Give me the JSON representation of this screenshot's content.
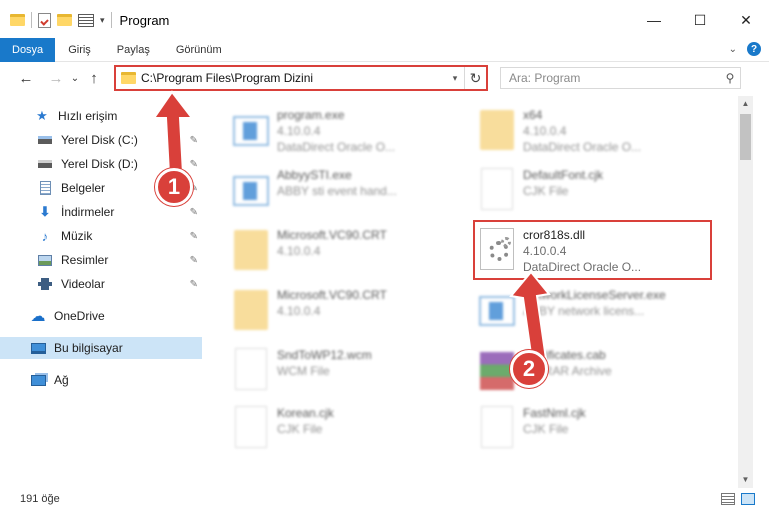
{
  "window": {
    "title": "Program",
    "controls": {
      "minimize": "—",
      "maximize": "☐",
      "close": "✕"
    }
  },
  "ribbon": {
    "tabs": [
      "Dosya",
      "Giriş",
      "Paylaş",
      "Görünüm"
    ],
    "active_tab": "Dosya",
    "help": "?"
  },
  "nav": {
    "back": "←",
    "forward": "→",
    "recent": "⌄",
    "up": "↑",
    "address": "C:\\Program Files\\Program Dizini",
    "search_placeholder": "Ara: Program"
  },
  "sidebar": {
    "items": [
      {
        "label": "Hızlı erişim",
        "icon": "star-icon",
        "pinned": false
      },
      {
        "label": "Yerel Disk (C:)",
        "icon": "drive-icon",
        "pinned": true
      },
      {
        "label": "Yerel Disk (D:)",
        "icon": "drive-icon",
        "pinned": true
      },
      {
        "label": "Belgeler",
        "icon": "documents-icon",
        "pinned": true
      },
      {
        "label": "İndirmeler",
        "icon": "download-icon",
        "pinned": true
      },
      {
        "label": "Müzik",
        "icon": "music-icon",
        "pinned": true
      },
      {
        "label": "Resimler",
        "icon": "pictures-icon",
        "pinned": true
      },
      {
        "label": "Videolar",
        "icon": "videos-icon",
        "pinned": true
      },
      {
        "label": "OneDrive",
        "icon": "cloud-icon",
        "pinned": false
      },
      {
        "label": "Bu bilgisayar",
        "icon": "computer-icon",
        "pinned": false,
        "selected": true
      },
      {
        "label": "Ağ",
        "icon": "network-icon",
        "pinned": false
      }
    ]
  },
  "files": [
    {
      "name": "program.exe",
      "line2": "4.10.0.4",
      "line3": "DataDirect Oracle O...",
      "type": "exe",
      "blurred": true
    },
    {
      "name": "x64",
      "line2": "4.10.0.4",
      "line3": "DataDirect Oracle O...",
      "type": "folder",
      "blurred": true
    },
    {
      "name": "AbbyySTI.exe",
      "line2": "ABBY sti event hand...",
      "line3": "",
      "type": "exe",
      "blurred": true
    },
    {
      "name": "DefaultFont.cjk",
      "line2": "CJK File",
      "line3": "",
      "type": "doc",
      "blurred": true
    },
    {
      "name": "Microsoft.VC90.CRT",
      "line2": "4.10.0.4",
      "line3": "",
      "type": "folder",
      "blurred": true
    },
    {
      "name": "cror818s.dll",
      "line2": "4.10.0.4",
      "line3": "DataDirect Oracle O...",
      "type": "dll",
      "blurred": false
    },
    {
      "name": "Microsoft.VC90.CRT",
      "line2": "4.10.0.4",
      "line3": "",
      "type": "folder",
      "blurred": true
    },
    {
      "name": "NetworkLicenseServer.exe",
      "line2": "ABBY network licens...",
      "line3": "",
      "type": "exe",
      "blurred": true
    },
    {
      "name": "SndToWP12.wcm",
      "line2": "WCM File",
      "line3": "",
      "type": "doc",
      "blurred": true
    },
    {
      "name": "Certificates.cab",
      "line2": "WinRAR Archive",
      "line3": "",
      "type": "rar",
      "blurred": true
    },
    {
      "name": "Korean.cjk",
      "line2": "CJK File",
      "line3": "",
      "type": "doc",
      "blurred": true
    },
    {
      "name": "FastNml.cjk",
      "line2": "CJK File",
      "line3": "",
      "type": "doc",
      "blurred": true
    }
  ],
  "callouts": [
    "1",
    "2"
  ],
  "status": {
    "count": "191 öğe"
  },
  "colors": {
    "accent": "#1979ca",
    "highlight": "#d9403a",
    "selected_bg": "#cce4f7"
  }
}
